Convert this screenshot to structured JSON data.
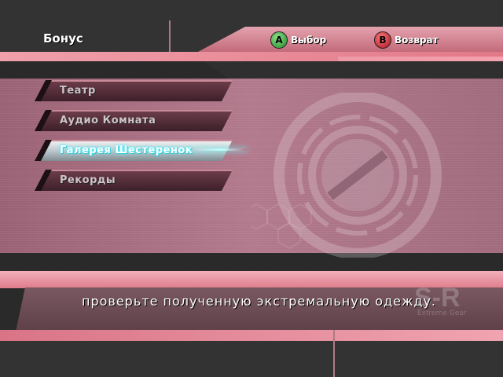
{
  "header": {
    "title": "Бонус"
  },
  "prompts": {
    "a": {
      "glyph": "A",
      "label": "Выбор",
      "icon": "a-button-icon",
      "color": "#2fa83a"
    },
    "b": {
      "glyph": "B",
      "label": "Возврат",
      "icon": "b-button-icon",
      "color": "#c0182c"
    }
  },
  "menu": {
    "items": [
      {
        "label": "Театр",
        "selected": false
      },
      {
        "label": "Аудио Комната",
        "selected": false
      },
      {
        "label": "Галерея Шестеренок",
        "selected": true
      },
      {
        "label": "Рекорды",
        "selected": false
      }
    ]
  },
  "hint": {
    "text": "проверьте полученную экстремальную одежду."
  },
  "logo": {
    "main": "S-R",
    "sub": "Extreme Gear"
  },
  "colors": {
    "accent_pink": "#e27888",
    "panel": "#a06b7d",
    "selected_glow": "#66ffff"
  }
}
